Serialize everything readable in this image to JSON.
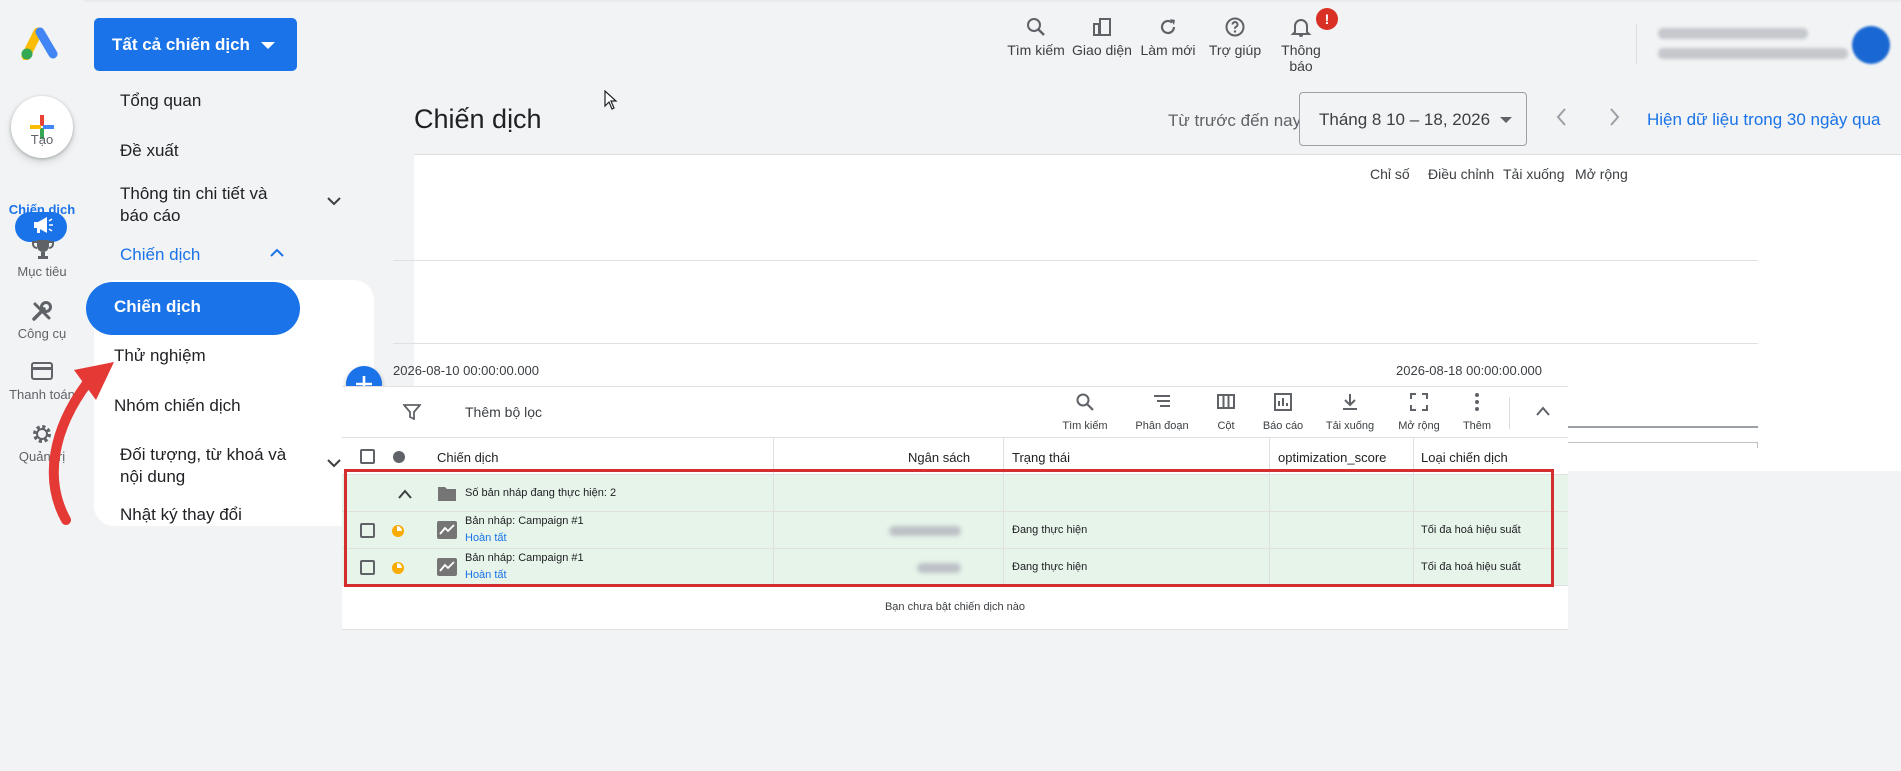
{
  "app": {
    "create_label": "Tạo",
    "account_button": "Tất cả chiến dịch"
  },
  "rail": {
    "items": [
      {
        "label": "Chiến dịch",
        "icon": "megaphone-icon",
        "active": true
      },
      {
        "label": "Mục tiêu",
        "icon": "trophy-icon"
      },
      {
        "label": "Công cụ",
        "icon": "tools-icon"
      },
      {
        "label": "Thanh toán",
        "icon": "credit-card-icon"
      },
      {
        "label": "Quản trị",
        "icon": "gear-icon"
      }
    ]
  },
  "top_actions": [
    {
      "label": "Tìm kiếm",
      "icon": "search-icon"
    },
    {
      "label": "Giao diện",
      "icon": "appearance-icon"
    },
    {
      "label": "Làm mới",
      "icon": "refresh-icon"
    },
    {
      "label": "Trợ giúp",
      "icon": "help-icon"
    },
    {
      "label": "Thông báo",
      "icon": "bell-icon",
      "badge": "!"
    }
  ],
  "nav": {
    "overview": "Tổng quan",
    "recommendations": "Đề xuất",
    "insights": "Thông tin chi tiết và báo cáo",
    "campaigns_group": "Chiến dịch",
    "campaigns": "Chiến dịch",
    "experiments": "Thử nghiệm",
    "campaign_groups": "Nhóm chiến dịch",
    "audiences": "Đối tượng, từ khoá và nội dung",
    "change_history": "Nhật ký thay đổi"
  },
  "header": {
    "title": "Chiến dịch",
    "range_label": "Từ trước đến nay",
    "date_range": "Tháng 8 10 – 18, 2026",
    "last_30_link": "Hiện dữ liệu trong 30 ngày qua"
  },
  "chart": {
    "tools": [
      "Chỉ số",
      "Điều chỉnh",
      "Tải xuống",
      "Mở rộng"
    ],
    "x_start": "2026-08-10 00:00:00.000",
    "x_end": "2026-08-18 00:00:00.000"
  },
  "table_toolbar": {
    "add_filter": "Thêm bộ lọc",
    "actions": [
      {
        "label": "Tìm kiếm",
        "icon": "search-icon"
      },
      {
        "label": "Phân đoạn",
        "icon": "segment-icon"
      },
      {
        "label": "Cột",
        "icon": "columns-icon"
      },
      {
        "label": "Báo cáo",
        "icon": "report-icon"
      },
      {
        "label": "Tải xuống",
        "icon": "download-icon"
      },
      {
        "label": "Mở rộng",
        "icon": "expand-icon"
      },
      {
        "label": "Thêm",
        "icon": "more-vert-icon"
      }
    ]
  },
  "table": {
    "columns": [
      "Chiến dịch",
      "Ngân sách",
      "Trạng thái",
      "optimization_score",
      "Loại chiến dịch"
    ],
    "group_row": "Số bản nháp đang thực hiện: 2",
    "rows": [
      {
        "name": "Bản nháp: Campaign #1",
        "sub": "Hoàn tất",
        "status": "Đang thực hiện",
        "type": "Tối đa hoá hiệu suất"
      },
      {
        "name": "Bản nháp: Campaign #1",
        "sub": "Hoàn tất",
        "status": "Đang thực hiện",
        "type": "Tối đa hoá hiệu suất"
      }
    ],
    "empty_message": "Bạn chưa bật chiến dịch nào"
  }
}
